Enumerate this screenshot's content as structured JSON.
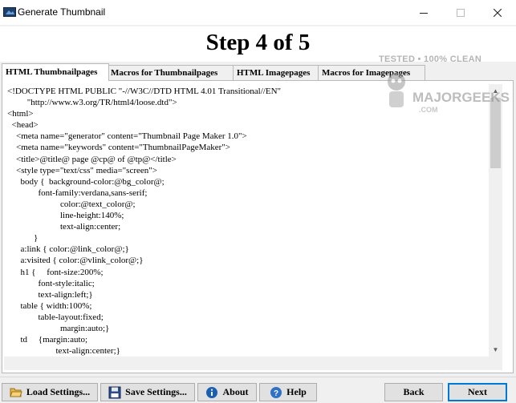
{
  "window": {
    "title": "Generate Thumbnail"
  },
  "header": {
    "step_title": "Step 4 of 5"
  },
  "tabs": [
    {
      "label": "HTML Thumbnailpages",
      "active": true
    },
    {
      "label": "Macros for Thumbnailpages",
      "active": false
    },
    {
      "label": "HTML Imagepages",
      "active": false
    },
    {
      "label": "Macros for Imagepages",
      "active": false
    }
  ],
  "editor": {
    "content": "<!DOCTYPE HTML PUBLIC \"-//W3C//DTD HTML 4.01 Transitional//EN\"\n         \"http://www.w3.org/TR/html4/loose.dtd\">\n<html>\n  <head>\n    <meta name=\"generator\" content=\"Thumbnail Page Maker 1.0\">\n    <meta name=\"keywords\" content=\"ThumbnailPageMaker\">\n    <title>@title@ page @cp@ of @tp@</title>\n    <style type=\"text/css\" media=\"screen\">\n      body {  background-color:@bg_color@;\n              font-family:verdana,sans-serif;\n                        color:@text_color@;\n                        line-height:140%;\n                        text-align:center;\n            }\n      a:link { color:@link_color@;}\n      a:visited { color:@vlink_color@;}\n      h1 {     font-size:200%;\n              font-style:italic;\n              text-align:left;}\n      table { width:100%;\n              table-layout:fixed;\n                        margin:auto;}\n      td     {margin:auto;\n                      text-align:center;}"
  },
  "watermark": {
    "line1": "TESTED • 100% CLEAN",
    "line2": "MAJORGEEKS",
    "line3": ".COM"
  },
  "buttons": {
    "load_settings": "Load Settings...",
    "save_settings": "Save Settings...",
    "about": "About",
    "help": "Help",
    "back": "Back",
    "next": "Next"
  }
}
